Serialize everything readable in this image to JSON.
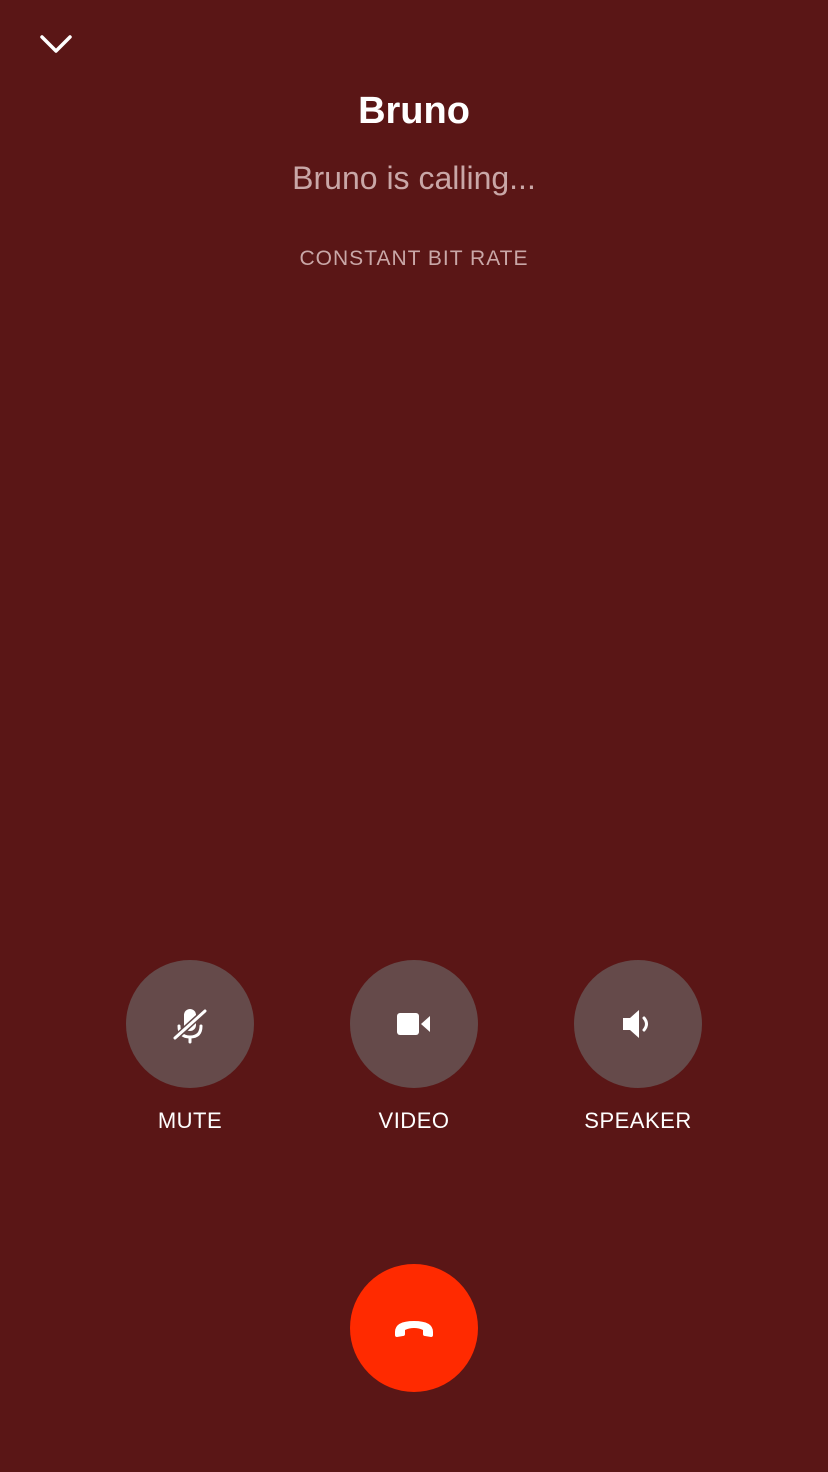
{
  "header": {
    "minimize_icon": "chevron-down-icon"
  },
  "caller": {
    "name": "Bruno",
    "status": "Bruno is calling...",
    "codec": "CONSTANT BIT RATE"
  },
  "controls": [
    {
      "id": "mute",
      "label": "MUTE",
      "icon": "mic-off-icon"
    },
    {
      "id": "video",
      "label": "VIDEO",
      "icon": "video-camera-icon"
    },
    {
      "id": "speaker",
      "label": "SPEAKER",
      "icon": "speaker-icon"
    }
  ],
  "hangup": {
    "icon": "phone-hangup-icon"
  },
  "colors": {
    "background": "#5a1616",
    "control_circle": "#654a4a",
    "hangup": "#ff2a00",
    "secondary_text": "#c9a7a7"
  }
}
